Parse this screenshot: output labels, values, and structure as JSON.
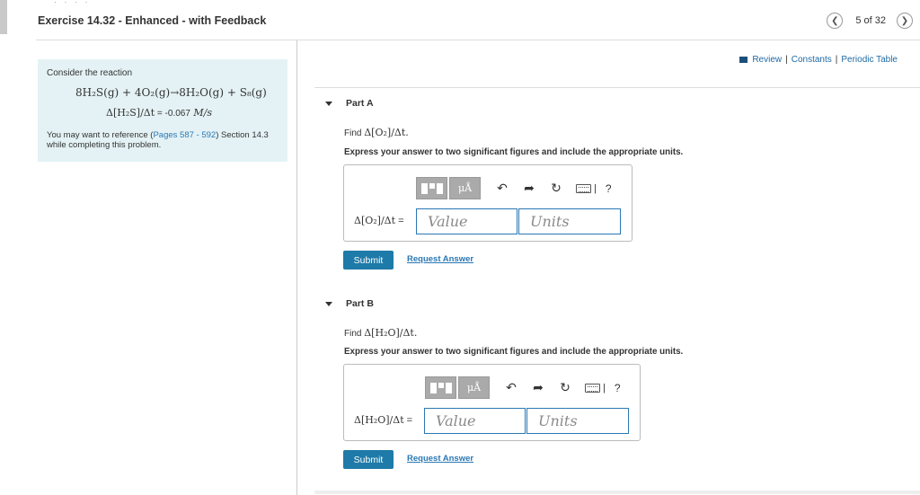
{
  "header": {
    "title": "Exercise 14.32 - Enhanced - with Feedback",
    "nav_count": "5 of 32",
    "prev_icon": "chevron-left-icon",
    "next_icon": "chevron-right-icon"
  },
  "links": {
    "review": "Review",
    "separator": "|",
    "constants": "Constants",
    "periodic_table": "Periodic Table"
  },
  "problem": {
    "consider": "Consider the reaction",
    "reaction": "8H₂S(g) + 4O₂(g)→8H₂O(g) + S₈(g)",
    "rate_label": "Δ[H₂S]/Δt",
    "rate_eq": " = ",
    "rate_value": "-0.067",
    "rate_units": " M/s",
    "ref_before": "You may want to reference (",
    "ref_link": "Pages 587 - 592",
    "ref_after": ") Section 14.3 while completing this problem."
  },
  "parts": [
    {
      "title": "Part A",
      "find_prefix": "Find ",
      "find_expr": "Δ[O₂]/Δt.",
      "instruction": "Express your answer to two significant figures and include the appropriate units.",
      "answer_label": "Δ[O₂]/Δt",
      "answer_eq": " =",
      "value_placeholder": "Value",
      "units_placeholder": "Units",
      "submit_label": "Submit",
      "request_label": "Request Answer"
    },
    {
      "title": "Part B",
      "find_prefix": "Find ",
      "find_expr": "Δ[H₂O]/Δt.",
      "instruction": "Express your answer to two significant figures and include the appropriate units.",
      "answer_label": "Δ[H₂O]/Δt",
      "answer_eq": " =",
      "value_placeholder": "Value",
      "units_placeholder": "Units",
      "submit_label": "Submit",
      "request_label": "Request Answer"
    }
  ],
  "toolbar": {
    "mu_label": "μÅ",
    "help": "?",
    "icons": [
      "templates-icon",
      "units-icon",
      "undo-icon",
      "redo-icon",
      "reset-icon",
      "keyboard-icon",
      "help-icon"
    ]
  },
  "colors": {
    "accent": "#1e7aa8",
    "link": "#2a78b5",
    "problem_bg": "#e4f2f5",
    "toolbar_btn": "#aaaaaa"
  }
}
